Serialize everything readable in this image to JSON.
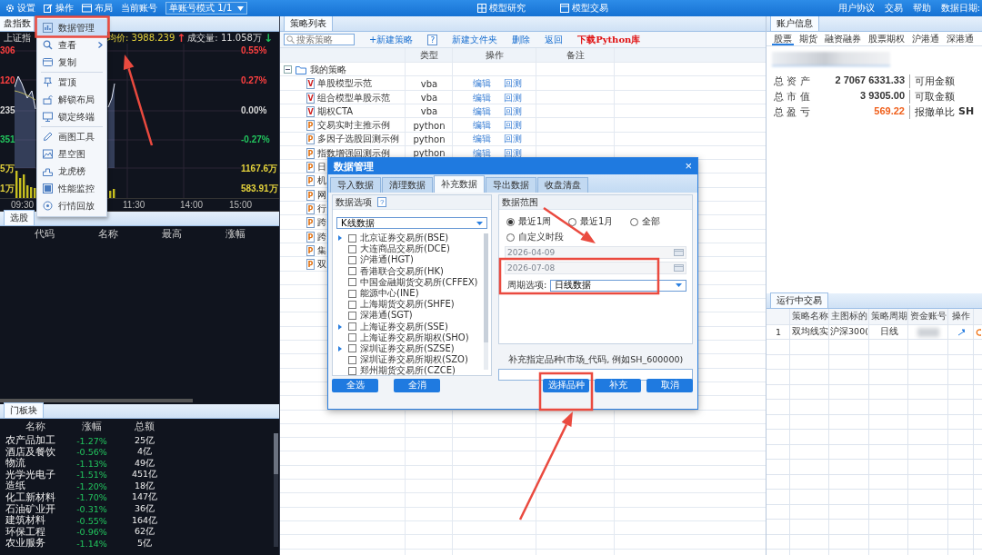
{
  "top_bar": {
    "menus": [
      {
        "label": "设置"
      },
      {
        "label": "操作"
      },
      {
        "label": "布局"
      }
    ],
    "account_label": "当前账号",
    "account_mode": "单账号模式 1/1",
    "center_tabs": [
      {
        "label": "模型研究"
      },
      {
        "label": "模型交易"
      }
    ],
    "links": [
      "用户协议",
      "交易",
      "帮助",
      "数据日期:"
    ]
  },
  "index_panel": {
    "tab": "盘指数",
    "name": "上证指",
    "avg": "均价: 3988.239",
    "avg_arrow": {
      "text": "↑",
      "color": "#ff4040"
    },
    "volume": "成交量: 11.058万",
    "volume_arrow": {
      "text": "↓",
      "color": "#22c55e"
    },
    "left_axis": [
      {
        "text": "306",
        "color": "#ff4040"
      },
      {
        "text": "120",
        "color": "#ff4040"
      },
      {
        "text": "235",
        "color": "#d8d8d8"
      },
      {
        "text": "351",
        "color": "#22c55e"
      },
      {
        "text": "5万",
        "color": "#e4d23c"
      },
      {
        "text": "1万",
        "color": "#e4d23c"
      }
    ],
    "right_axis": [
      {
        "text": "0.55%",
        "color": "#ff4040"
      },
      {
        "text": "0.27%",
        "color": "#ff4040"
      },
      {
        "text": "0.00%",
        "color": "#d8d8d8"
      },
      {
        "text": "-0.27%",
        "color": "#22c55e"
      },
      {
        "text": "1167.6万",
        "color": "#e4d23c"
      },
      {
        "text": "583.91万",
        "color": "#e4d23c"
      }
    ],
    "time_axis": [
      "09:30",
      "11:30",
      "14:00",
      "15:00"
    ]
  },
  "select_panel": {
    "tab": "选股",
    "columns": [
      "代码",
      "名称",
      "最高",
      "涨幅"
    ]
  },
  "sector_panel": {
    "tab": "门板块",
    "columns": [
      "名称",
      "涨幅",
      "总额"
    ],
    "rows": [
      {
        "name": "农产品加工",
        "change": "-1.27%",
        "amount": "25亿"
      },
      {
        "name": "酒店及餐饮",
        "change": "-0.56%",
        "amount": "4亿"
      },
      {
        "name": "物流",
        "change": "-1.13%",
        "amount": "49亿"
      },
      {
        "name": "光学光电子",
        "change": "-1.51%",
        "amount": "451亿"
      },
      {
        "name": "造纸",
        "change": "-1.20%",
        "amount": "18亿"
      },
      {
        "name": "化工新材料",
        "change": "-1.70%",
        "amount": "147亿"
      },
      {
        "name": "石油矿业开",
        "change": "-0.31%",
        "amount": "36亿"
      },
      {
        "name": "建筑材料",
        "change": "-0.55%",
        "amount": "164亿"
      },
      {
        "name": "环保工程",
        "change": "-0.96%",
        "amount": "62亿"
      },
      {
        "name": "农业服务",
        "change": "-1.14%",
        "amount": "5亿"
      }
    ]
  },
  "context_menu": {
    "groups": [
      {
        "items": [
          {
            "label": "数据管理",
            "selected": true,
            "has_submenu": false
          },
          {
            "label": "查看",
            "selected": false,
            "has_submenu": true
          },
          {
            "label": "复制",
            "selected": false,
            "has_submenu": false
          }
        ]
      },
      {
        "items": [
          {
            "label": "置顶",
            "selected": false,
            "has_submenu": false
          },
          {
            "label": "解锁布局",
            "selected": false,
            "has_submenu": false
          },
          {
            "label": "锁定终端",
            "selected": false,
            "has_submenu": false
          }
        ]
      },
      {
        "items": [
          {
            "label": "画图工具",
            "selected": false,
            "has_submenu": false
          },
          {
            "label": "星空图",
            "selected": false,
            "has_submenu": false
          },
          {
            "label": "龙虎榜",
            "selected": false,
            "has_submenu": false
          },
          {
            "label": "性能监控",
            "selected": false,
            "has_submenu": false
          },
          {
            "label": "行情回放",
            "selected": false,
            "has_submenu": false
          }
        ]
      }
    ]
  },
  "strategy_panel": {
    "tab": "策略列表",
    "search": {
      "placeholder": "搜索策略"
    },
    "toolbar": [
      {
        "label": "+新建策略",
        "kind": "link"
      },
      {
        "label": "?",
        "kind": "help"
      },
      {
        "label": "新建文件夹",
        "kind": "link"
      },
      {
        "label": "删除",
        "kind": "link"
      },
      {
        "label": "返回",
        "kind": "link"
      },
      {
        "label": "下载Python库",
        "kind": "accent"
      }
    ],
    "columns": [
      "类型",
      "操作",
      "备注"
    ],
    "folder": {
      "label": "我的策略",
      "expanded": true,
      "children": [
        {
          "name": "单股模型示范",
          "kind": "vba",
          "badge": "V",
          "type": "vba",
          "actions": [
            "编辑",
            "回测"
          ]
        },
        {
          "name": "组合模型单股示范",
          "kind": "vba",
          "badge": "V",
          "type": "vba",
          "actions": [
            "编辑",
            "回测"
          ]
        },
        {
          "name": "期权CTA",
          "kind": "vba",
          "badge": "V",
          "type": "vba",
          "actions": [
            "编辑",
            "回测"
          ]
        },
        {
          "name": "交易实时主推示例",
          "kind": "python",
          "badge": "P",
          "type": "python",
          "actions": [
            "编辑",
            "回测"
          ]
        },
        {
          "name": "多因子选股回测示例",
          "kind": "python",
          "badge": "P",
          "type": "python",
          "actions": [
            "编辑",
            "回测"
          ]
        },
        {
          "name": "指数增强回测示例",
          "kind": "python",
          "badge": "P",
          "type": "python",
          "actions": [
            "编辑",
            "回测"
          ]
        },
        {
          "name": "日",
          "kind": "python",
          "badge": "P"
        },
        {
          "name": "机",
          "kind": "python",
          "badge": "P"
        },
        {
          "name": "网",
          "kind": "python",
          "badge": "P"
        },
        {
          "name": "行",
          "kind": "python",
          "badge": "P"
        },
        {
          "name": "跨",
          "kind": "python",
          "badge": "P"
        },
        {
          "name": "跨",
          "kind": "python",
          "badge": "P"
        },
        {
          "name": "集",
          "kind": "python",
          "badge": "P"
        },
        {
          "name": "双",
          "kind": "python",
          "badge": "P"
        }
      ]
    }
  },
  "account_panel": {
    "tab": "账户信息",
    "subtabs": [
      {
        "label": "股票",
        "selected": true
      },
      {
        "label": "期货",
        "selected": false
      },
      {
        "label": "融资融券",
        "selected": false
      },
      {
        "label": "股票期权",
        "selected": false
      },
      {
        "label": "沪港通",
        "selected": false
      },
      {
        "label": "深港通",
        "selected": false
      }
    ],
    "stats": [
      {
        "label": "总 资 产",
        "value": "2 7067 6331.33",
        "color": "#333333",
        "side": "可用金额"
      },
      {
        "label": "总 市 值",
        "value": "3 9305.00",
        "color": "#333333",
        "side": "可取金额"
      },
      {
        "label": "总 盈 亏",
        "value": "569.22",
        "color": "#f0601c",
        "side": "报撤单比",
        "side_value": "SH"
      }
    ]
  },
  "running_panel": {
    "tab": "运行中交易",
    "columns": [
      "策略名称",
      "主图标的",
      "策略周期",
      "资金账号",
      "操作"
    ],
    "rows": [
      {
        "index": "1",
        "name": "双均线实",
        "symbol": "沪深300(",
        "period": "日线"
      }
    ]
  },
  "dialog": {
    "title": "数据管理",
    "close": "×",
    "tabs": [
      {
        "label": "导入数据",
        "selected": false
      },
      {
        "label": "清理数据",
        "selected": false
      },
      {
        "label": "补充数据",
        "selected": true
      },
      {
        "label": "导出数据",
        "selected": false
      },
      {
        "label": "收盘清盘",
        "selected": false
      }
    ],
    "options_title": "数据选项",
    "options_help": "?",
    "data_type": "K线数据",
    "markets": [
      {
        "label": "北京证券交易所(BSE)",
        "checked": false,
        "expandable": true
      },
      {
        "label": "大连商品交易所(DCE)",
        "checked": false,
        "expandable": false
      },
      {
        "label": "沪港通(HGT)",
        "checked": false,
        "expandable": false
      },
      {
        "label": "香港联合交易所(HK)",
        "checked": false,
        "expandable": false
      },
      {
        "label": "中国金融期货交易所(CFFEX)",
        "checked": false,
        "expandable": false
      },
      {
        "label": "能源中心(INE)",
        "checked": false,
        "expandable": false
      },
      {
        "label": "上海期货交易所(SHFE)",
        "checked": false,
        "expandable": false
      },
      {
        "label": "深港通(SGT)",
        "checked": false,
        "expandable": false
      },
      {
        "label": "上海证券交易所(SSE)",
        "checked": false,
        "expandable": true
      },
      {
        "label": "上海证券交易所期权(SHO)",
        "checked": false,
        "expandable": false
      },
      {
        "label": "深圳证券交易所(SZSE)",
        "checked": false,
        "expandable": true
      },
      {
        "label": "深圳证券交易所期权(SZO)",
        "checked": false,
        "expandable": false
      },
      {
        "label": "郑州期货交易所(CZCE)",
        "checked": false,
        "expandable": false
      }
    ],
    "left_buttons": [
      "全选",
      "全消"
    ],
    "range": {
      "title": "数据范围",
      "radios": [
        {
          "label": "最近1周",
          "selected": true
        },
        {
          "label": "最近1月",
          "selected": false
        },
        {
          "label": "全部",
          "selected": false
        },
        {
          "label": "自定义时段",
          "selected": false
        }
      ],
      "dates": [
        {
          "value": "2026-04-09",
          "disabled": true
        },
        {
          "value": "2026-07-08",
          "disabled": true
        }
      ],
      "period_label": "周期选项:",
      "period": "日线数据"
    },
    "symbol_label": "补充指定品种(市场_代码, 例如SH_600000)",
    "right_buttons": [
      "选择品种",
      "补充",
      "取消"
    ]
  }
}
